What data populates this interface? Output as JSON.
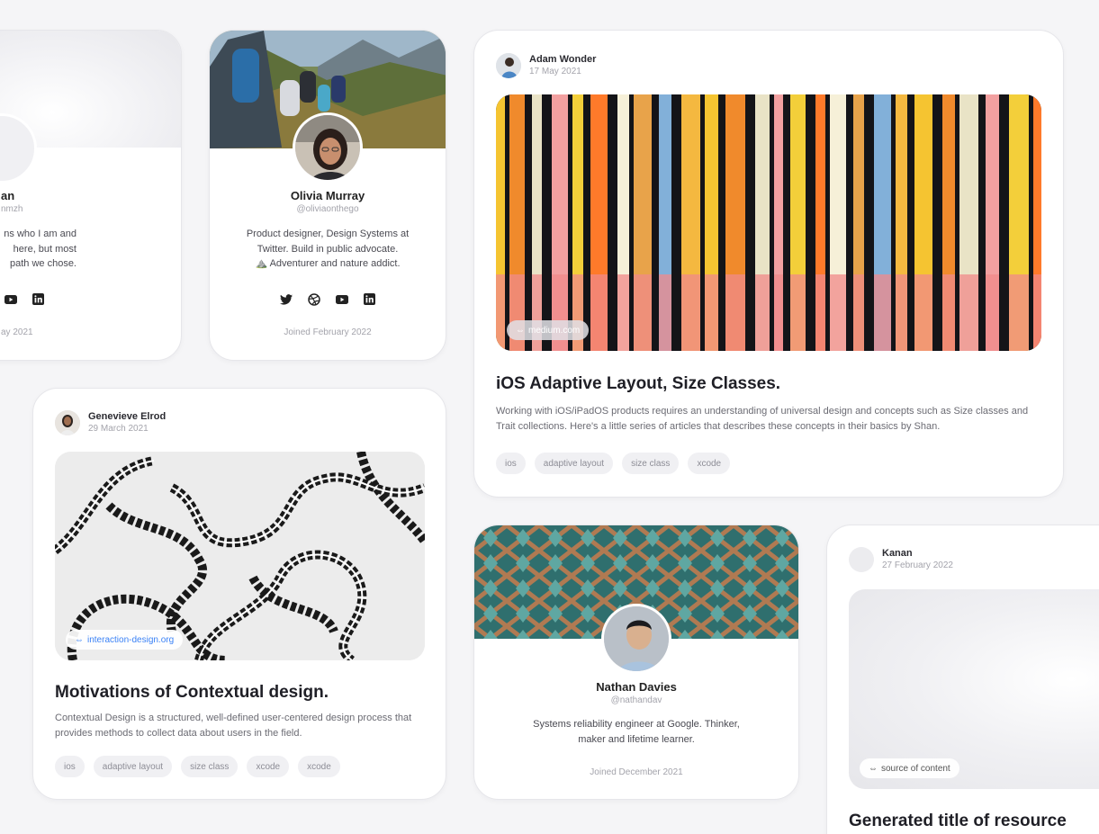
{
  "colors": {
    "background": "#f5f5f7",
    "card": "#ffffff",
    "link_blue": "#3b82f6",
    "tag_bg": "#f0f0f3"
  },
  "profiles": [
    {
      "name": "an",
      "handle": "nmzh",
      "bio": [
        "ns who I am and",
        "here, but most",
        "path we chose."
      ],
      "social": [
        "youtube-icon",
        "linkedin-icon"
      ],
      "joined": "ay 2021"
    },
    {
      "name": "Olivia Murray",
      "handle": "@oliviaonthego",
      "bio": [
        "Product designer, Design Systems at",
        "Twitter. Build in public advocate.",
        "⛰️ Adventurer and nature addict."
      ],
      "social": [
        "twitter-icon",
        "dribbble-icon",
        "youtube-icon",
        "linkedin-icon"
      ],
      "joined": "Joined February 2022"
    },
    {
      "name": "Nathan Davies",
      "handle": "@nathandav",
      "bio": [
        "Systems reliability engineer at Google. Thinker,",
        "maker and lifetime learner."
      ],
      "joined": "Joined December 2021"
    }
  ],
  "articles": [
    {
      "author": "Adam Wonder",
      "date": "17 May 2021",
      "source": "medium.com",
      "title": "iOS Adaptive Layout, Size Classes.",
      "description": "Working with iOS/iPadOS products requires an understanding of universal design and concepts such as Size classes and Trait collections. Here's a little series of articles that describes these concepts in their basics by Shan.",
      "tags": [
        "ios",
        "adaptive layout",
        "size class",
        "xcode"
      ]
    },
    {
      "author": "Genevieve Elrod",
      "date": "29 March 2021",
      "source": "interaction-design.org",
      "title": "Motivations of Contextual design.",
      "description": "Contextual Design is a structured, well-defined user-centered design process that provides methods to collect data about users in the field.",
      "tags": [
        "ios",
        "adaptive layout",
        "size class",
        "xcode",
        "xcode"
      ]
    },
    {
      "author": "Kanan",
      "date": "27 February 2022",
      "source": "source of content",
      "title": "Generated title of resource"
    }
  ]
}
